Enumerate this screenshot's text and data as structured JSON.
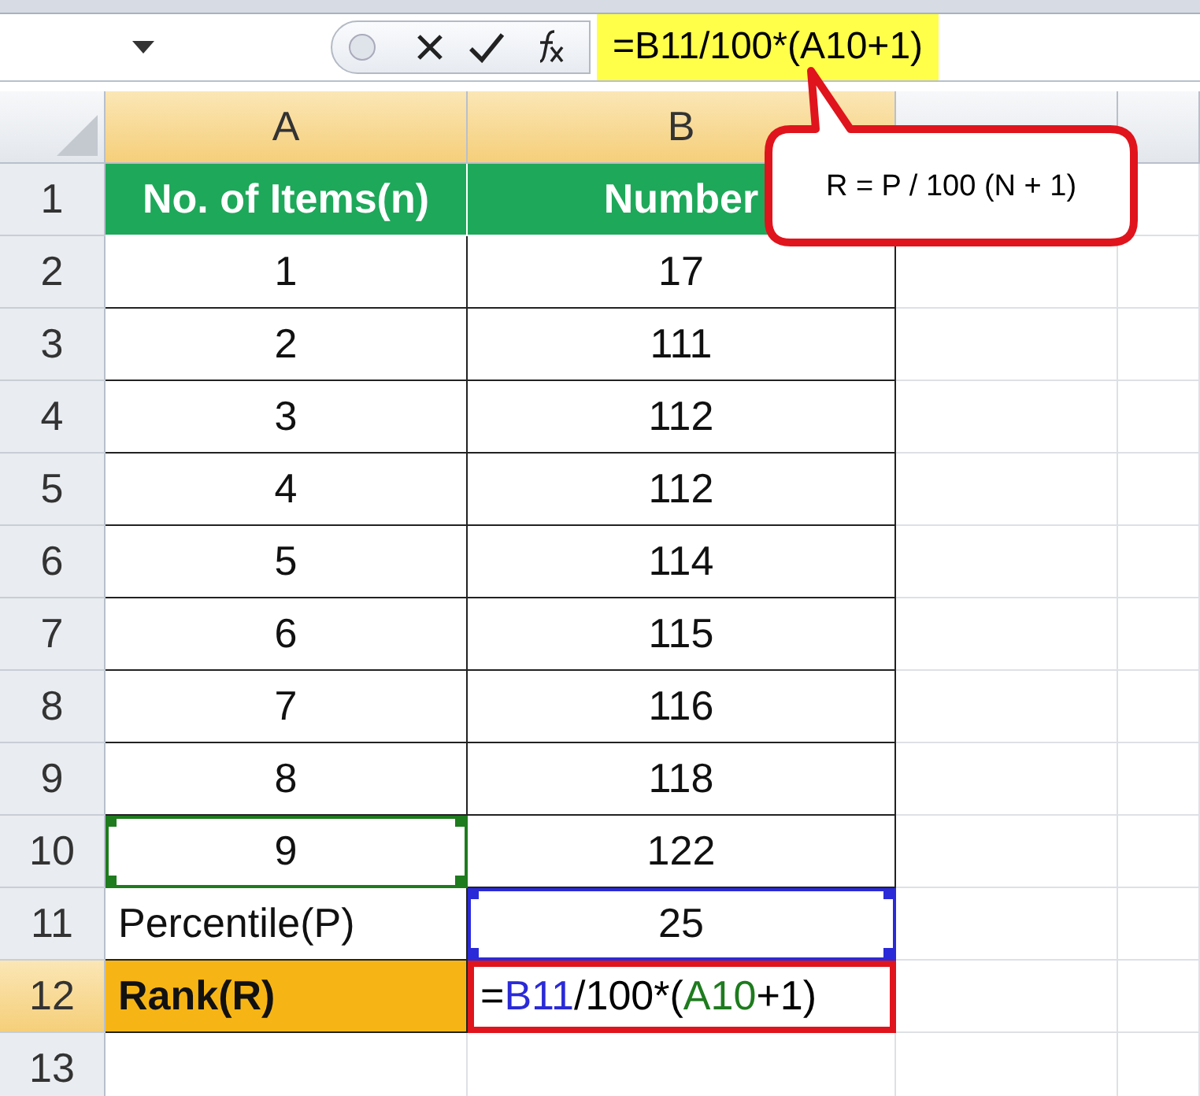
{
  "formula_bar": {
    "formula": "=B11/100*(A10+1)",
    "highlighted": true
  },
  "callout": {
    "text": "R = P / 100 (N + 1)"
  },
  "columns": [
    {
      "label": "A",
      "selected": true
    },
    {
      "label": "B",
      "selected": true
    }
  ],
  "rows": [
    {
      "number": "1",
      "selected": false,
      "cells": [
        {
          "kind": "header",
          "text": "No. of Items(n)"
        },
        {
          "kind": "header",
          "text": "Number"
        }
      ]
    },
    {
      "number": "2",
      "selected": false,
      "cells": [
        {
          "kind": "value",
          "text": "1"
        },
        {
          "kind": "value",
          "text": "17"
        }
      ]
    },
    {
      "number": "3",
      "selected": false,
      "cells": [
        {
          "kind": "value",
          "text": "2"
        },
        {
          "kind": "value",
          "text": "111"
        }
      ]
    },
    {
      "number": "4",
      "selected": false,
      "cells": [
        {
          "kind": "value",
          "text": "3"
        },
        {
          "kind": "value",
          "text": "112"
        }
      ]
    },
    {
      "number": "5",
      "selected": false,
      "cells": [
        {
          "kind": "value",
          "text": "4"
        },
        {
          "kind": "value",
          "text": "112"
        }
      ]
    },
    {
      "number": "6",
      "selected": false,
      "cells": [
        {
          "kind": "value",
          "text": "5"
        },
        {
          "kind": "value",
          "text": "114"
        }
      ]
    },
    {
      "number": "7",
      "selected": false,
      "cells": [
        {
          "kind": "value",
          "text": "6"
        },
        {
          "kind": "value",
          "text": "115"
        }
      ]
    },
    {
      "number": "8",
      "selected": false,
      "cells": [
        {
          "kind": "value",
          "text": "7"
        },
        {
          "kind": "value",
          "text": "116"
        }
      ]
    },
    {
      "number": "9",
      "selected": false,
      "cells": [
        {
          "kind": "value",
          "text": "8"
        },
        {
          "kind": "value",
          "text": "118"
        }
      ]
    },
    {
      "number": "10",
      "selected": false,
      "cells": [
        {
          "kind": "value",
          "text": "9",
          "color": "#1e7b1e"
        },
        {
          "kind": "value",
          "text": "122"
        }
      ]
    },
    {
      "number": "11",
      "selected": false,
      "cells": [
        {
          "kind": "label",
          "text": "Percentile(P)"
        },
        {
          "kind": "value",
          "text": "25",
          "color": "#2a2ad8"
        }
      ]
    },
    {
      "number": "12",
      "selected": true,
      "cells": [
        {
          "kind": "rank",
          "text": "Rank(R)"
        },
        {
          "kind": "formula",
          "parts": [
            {
              "text": "=",
              "color": "#000000"
            },
            {
              "text": "B11",
              "color": "#2a2ad8"
            },
            {
              "text": "/100*(",
              "color": "#000000"
            },
            {
              "text": "A10",
              "color": "#1e7b1e"
            },
            {
              "text": "+1)",
              "color": "#000000"
            }
          ]
        }
      ]
    },
    {
      "number": "13",
      "selected": false,
      "cells": []
    }
  ]
}
